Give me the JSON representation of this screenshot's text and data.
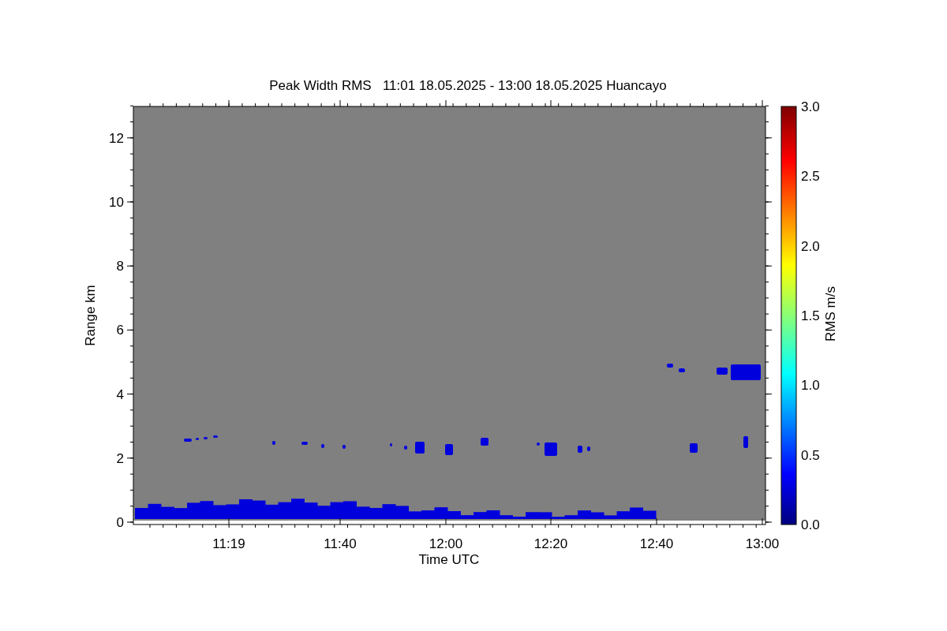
{
  "plot": {
    "title": "Peak Width RMS   11:01 18.05.2025 - 13:00 18.05.2025 Huancayo",
    "xlabel": "Time UTC",
    "ylabel": "Range km",
    "xticks": [
      "11:19",
      "11:40",
      "12:00",
      "12:20",
      "12:40",
      "13:00"
    ],
    "yticks": [
      "12",
      "10",
      "8",
      "6",
      "4",
      "2",
      "0"
    ]
  },
  "colorbar": {
    "label": "RMS m/s",
    "ticks": [
      "3.0",
      "2.5",
      "2.0",
      "1.5",
      "1.0",
      "0.5",
      "0.0"
    ]
  }
}
